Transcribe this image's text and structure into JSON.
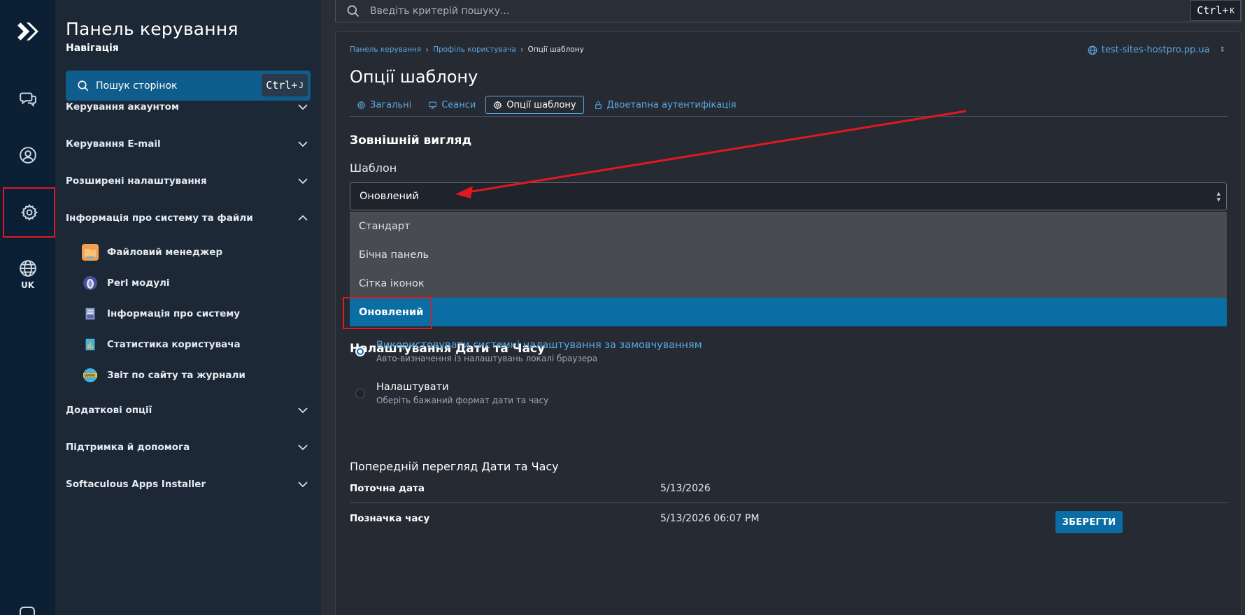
{
  "rail": {
    "lang_label": "UK"
  },
  "nav": {
    "title": "Панель керування",
    "subtitle": "Навігація",
    "search_label": "Пошук сторінок",
    "search_shortcut": "Ctrl+",
    "search_shortcut_key": "J",
    "sections": [
      "Керування акаунтом",
      "Керування E-mail",
      "Розширені налаштування",
      "Інформація про систему та файли",
      "Додаткові опції",
      "Підтримка й допомога",
      "Softaculous Apps Installer"
    ],
    "subitems": [
      {
        "label": "Файловий менеджер",
        "icon": "folder-icon"
      },
      {
        "label": "Perl модулі",
        "icon": "perl-onion-icon"
      },
      {
        "label": "Інформація про систему",
        "icon": "server-info-icon"
      },
      {
        "label": "Статистика користувача",
        "icon": "stats-icon"
      },
      {
        "label": "Звіт по сайту та журнали",
        "icon": "www-globe-icon"
      }
    ]
  },
  "top_search": {
    "placeholder": "Введіть критерій пошуку...",
    "shortcut": "Ctrl+",
    "shortcut_key": "K"
  },
  "breadcrumb": {
    "items": [
      "Панель керування",
      "Профіль користувача"
    ],
    "current": "Опції шаблону"
  },
  "domain": "test-sites-hostpro.pp.ua",
  "page_title": "Опції шаблону",
  "tabs": [
    {
      "label": "Загальні",
      "icon": "gear-icon"
    },
    {
      "label": "Сеанси",
      "icon": "monitor-icon"
    },
    {
      "label": "Опції шаблону",
      "icon": "gear-icon",
      "active": true
    },
    {
      "label": "Двоетапна аутентифікація",
      "icon": "lock-icon"
    }
  ],
  "appearance": {
    "heading": "Зовнішній вигляд",
    "template_label": "Шаблон",
    "selected": "Оновлений",
    "options": [
      "Стандарт",
      "Бічна панель",
      "Сітка іконок",
      "Оновлений"
    ]
  },
  "datetime": {
    "heading": "Налаштування Дати та Часу",
    "option_system_title": "Використовувати системні налаштування за замовчуванням",
    "option_system_desc": "Авто-визначення із налаштувань локалі браузера",
    "option_custom_title": "Налаштувати",
    "option_custom_desc": "Оберіть бажаний формат дати та часу",
    "selected": "system"
  },
  "preview": {
    "heading": "Попередній перегляд Дати та Часу",
    "date_label": "Поточна дата",
    "date_value": "5/13/2026",
    "time_label": "Позначка часу",
    "time_value": "5/13/2026 06:07 PM"
  },
  "save_label": "ЗБЕРЕГТИ",
  "colors": {
    "accent": "#0a6da3",
    "link": "#5aa8e0",
    "annotation": "#e01820"
  }
}
